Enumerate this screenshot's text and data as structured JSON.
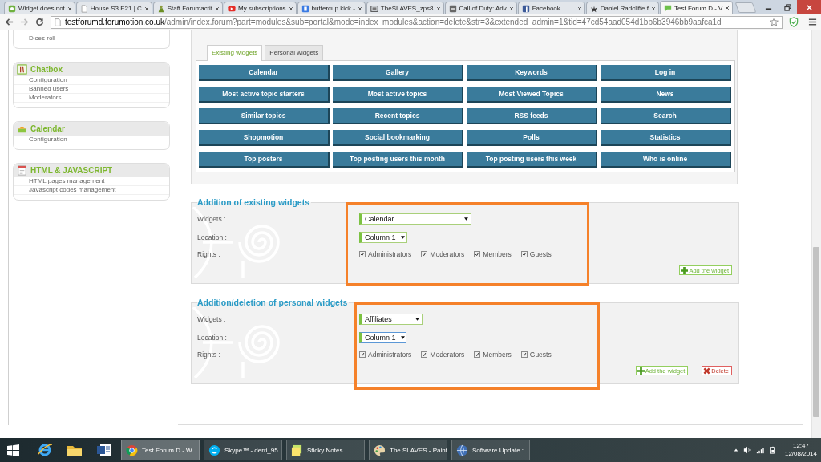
{
  "browser": {
    "tabs": [
      {
        "title": "Widget does not",
        "selected": false
      },
      {
        "title": "House S3 E21 | C",
        "selected": false
      },
      {
        "title": "Staff Forumactif",
        "selected": false
      },
      {
        "title": "My subscriptions",
        "selected": false
      },
      {
        "title": "buttercup kick -",
        "selected": false
      },
      {
        "title": "TheSLAVES_zps8",
        "selected": false
      },
      {
        "title": "Call of Duty: Adv",
        "selected": false
      },
      {
        "title": "Facebook",
        "selected": false
      },
      {
        "title": "Daniel Radcliffe f",
        "selected": false
      },
      {
        "title": "Test Forum D - V",
        "selected": true
      }
    ],
    "navigation": [
      {
        "kind": "back",
        "disabled": false
      },
      {
        "kind": "forward",
        "disabled": true
      },
      {
        "kind": "reload",
        "disabled": false
      }
    ],
    "address_bar": {
      "host": "testforumd.forumotion.co.uk",
      "path": "/admin/index.forum?part=modules&sub=portal&mode=index_modules&action=delete&str=3&extended_admin=1&tid=47cd54aad054d1bb6b3946bb9aafca1d"
    }
  },
  "sidebar": {
    "panels": [
      {
        "items": [
          "Dices roll"
        ]
      },
      {
        "title": "Chatbox",
        "items": [
          "Configuration",
          "Banned users",
          "Moderators"
        ]
      },
      {
        "title": "Calendar",
        "items": [
          "Configuration"
        ]
      },
      {
        "title": "HTML & JAVASCRIPT",
        "items": [
          "HTML pages management",
          "Javascript codes management"
        ]
      }
    ]
  },
  "widgets": {
    "tabs": [
      {
        "label": "Existing widgets",
        "selected": true
      },
      {
        "label": "Personal widgets",
        "selected": false
      }
    ],
    "buttons": [
      "Calendar",
      "Gallery",
      "Keywords",
      "Log in",
      "Most active topic starters",
      "Most active topics",
      "Most Viewed Topics",
      "News",
      "Similar topics",
      "Recent topics",
      "RSS feeds",
      "Search",
      "Shopmotion",
      "Social bookmarking",
      "Polls",
      "Statistics",
      "Top posters",
      "Top posting users this month",
      "Top posting users this week",
      "Who is online"
    ]
  },
  "sections": [
    {
      "title": "Addition of existing widgets",
      "fields": [
        {
          "kind": "select",
          "label": "Widgets :",
          "value": "Calendar",
          "focused": false
        },
        {
          "kind": "select",
          "label": "Location :",
          "value": "Column 1",
          "focused": false
        },
        {
          "kind": "checks",
          "label": "Rights :",
          "options": [
            {
              "label": "Administrators",
              "checked": true
            },
            {
              "label": "Moderators",
              "checked": true
            },
            {
              "label": "Members",
              "checked": true
            },
            {
              "label": "Guests",
              "checked": true
            }
          ]
        }
      ],
      "buttons": [
        {
          "kind": "add",
          "label": "Add the widget"
        }
      ]
    },
    {
      "title": "Addition/deletion of personal widgets",
      "fields": [
        {
          "kind": "select",
          "label": "Widgets :",
          "value": "Affiliates",
          "focused": false
        },
        {
          "kind": "select",
          "label": "Location :",
          "value": "Column 1",
          "focused": true
        },
        {
          "kind": "checks",
          "label": "Rights :",
          "options": [
            {
              "label": "Administrators",
              "checked": true
            },
            {
              "label": "Moderators",
              "checked": true
            },
            {
              "label": "Members",
              "checked": true
            },
            {
              "label": "Guests",
              "checked": true
            }
          ]
        }
      ],
      "buttons": [
        {
          "kind": "add",
          "label": "Add the widget"
        },
        {
          "kind": "delete",
          "label": "Delete"
        }
      ]
    }
  ],
  "taskbar": {
    "windows": [
      {
        "title": "Test Forum D - W...",
        "selected": true
      },
      {
        "title": "Skype™ - derri_95",
        "selected": false
      },
      {
        "title": "Sticky Notes",
        "selected": false
      },
      {
        "title": "The SLAVES - Paint",
        "selected": false
      },
      {
        "title": "Software Update :...",
        "selected": false
      }
    ],
    "clock": {
      "time": "12:47",
      "date": "12/08/2014"
    }
  }
}
